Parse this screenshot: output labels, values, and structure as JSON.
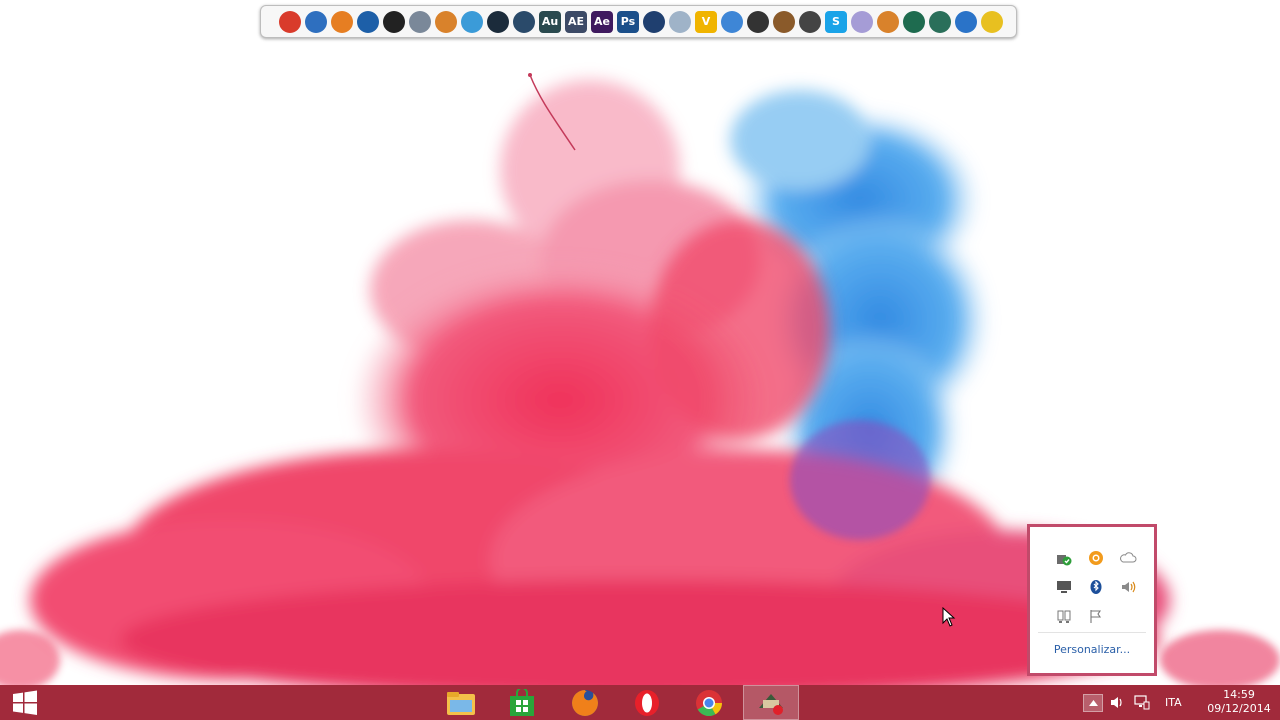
{
  "dock": {
    "icons": [
      {
        "name": "ccleaner-icon",
        "label": "",
        "color": "#d93b2b"
      },
      {
        "name": "wifi-tool-icon",
        "label": "",
        "color": "#2e6fbf"
      },
      {
        "name": "sumatra-icon",
        "label": "",
        "color": "#e67e22"
      },
      {
        "name": "cpuid-icon",
        "label": "",
        "color": "#1d5fa8"
      },
      {
        "name": "hat-icon",
        "label": "",
        "color": "#222222"
      },
      {
        "name": "finder-icon",
        "label": "",
        "color": "#7a8899"
      },
      {
        "name": "checklist-icon",
        "label": "",
        "color": "#d9822b"
      },
      {
        "name": "wing-icon",
        "label": "",
        "color": "#3b9bd8"
      },
      {
        "name": "camera-icon",
        "label": "",
        "color": "#1b2b3b"
      },
      {
        "name": "cinema-icon",
        "label": "",
        "color": "#2a4a6a"
      },
      {
        "name": "audition-icon",
        "label": "Au",
        "color": "#2a4a4f"
      },
      {
        "name": "ae-cs-icon",
        "label": "AE",
        "color": "#3c4a66"
      },
      {
        "name": "after-effects-icon",
        "label": "Ae",
        "color": "#3f1a5f"
      },
      {
        "name": "photoshop-icon",
        "label": "Ps",
        "color": "#1b4f8a"
      },
      {
        "name": "video-editor-icon",
        "label": "",
        "color": "#1f3f6f"
      },
      {
        "name": "document-icon",
        "label": "",
        "color": "#9fb3c8"
      },
      {
        "name": "vlc-icon",
        "label": "V",
        "color": "#f0b400"
      },
      {
        "name": "qbittorrent-icon",
        "label": "",
        "color": "#3e86d6"
      },
      {
        "name": "clock-app-icon",
        "label": "",
        "color": "#333333"
      },
      {
        "name": "character-icon",
        "label": "",
        "color": "#8a5a2a"
      },
      {
        "name": "figure-icon",
        "label": "",
        "color": "#444444"
      },
      {
        "name": "skype-icon",
        "label": "S",
        "color": "#1aa3e8"
      },
      {
        "name": "disc-icon",
        "label": "",
        "color": "#a59cd6"
      },
      {
        "name": "close-x-icon",
        "label": "",
        "color": "#d9822b"
      },
      {
        "name": "diamond-icon",
        "label": "",
        "color": "#1e6b4f"
      },
      {
        "name": "monitor-icon",
        "label": "",
        "color": "#2a6f5a"
      },
      {
        "name": "tools-icon",
        "label": "",
        "color": "#2a73c8"
      },
      {
        "name": "magic-wand-icon",
        "label": "",
        "color": "#e8c020"
      }
    ]
  },
  "tray_popup": {
    "icons": [
      "security-shield-icon",
      "avast-icon",
      "onedrive-cloud-icon",
      "display-icon",
      "bluetooth-icon",
      "volume-icon",
      "network-status-icon",
      "action-center-flag-icon"
    ],
    "customize_label": "Personalizar..."
  },
  "taskbar": {
    "background": "#a12a3b",
    "apps": [
      {
        "name": "file-explorer-icon",
        "active": false
      },
      {
        "name": "windows-store-icon",
        "active": false
      },
      {
        "name": "firefox-icon",
        "active": false
      },
      {
        "name": "opera-icon",
        "active": false
      },
      {
        "name": "chrome-icon",
        "active": false
      },
      {
        "name": "recording-app-icon",
        "active": true
      }
    ],
    "tray": {
      "language": "ITA",
      "time": "14:59",
      "date": "09/12/2014"
    }
  }
}
